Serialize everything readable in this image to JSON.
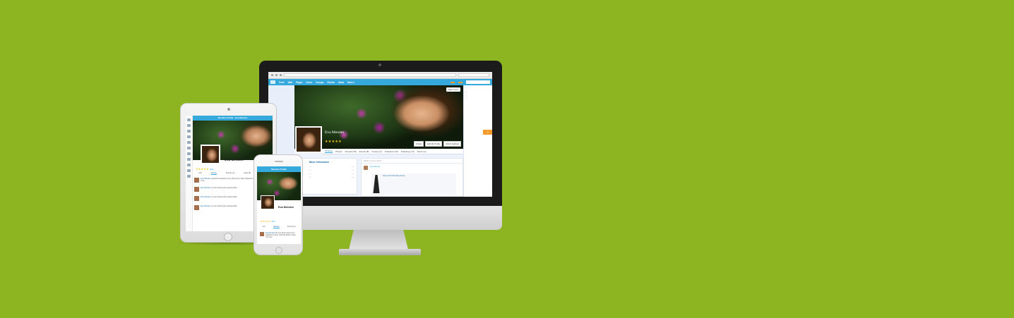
{
  "colors": {
    "background": "#8db522",
    "accent": "#35a9dc",
    "orange": "#f39c2c",
    "star": "#f5c518"
  },
  "desktop": {
    "nav": {
      "items": [
        "Feed",
        "Wall",
        "Pages",
        "Users",
        "Groups",
        "Events",
        "Ideas",
        "More ▾"
      ]
    },
    "profile": {
      "name": "Eva Mendes",
      "stars": "★★★★★",
      "edit_cover": "Edit Cover",
      "buttons": [
        "Follow",
        "Edit My Profile",
        "Admin Settings"
      ]
    },
    "tabs": [
      "Timeline",
      "Photos",
      "Friends (36)",
      "Events (8)",
      "Groups (2)",
      "Followers (18)",
      "Following (14)",
      "About me"
    ],
    "info": {
      "title": "Basic Information"
    },
    "feed": {
      "composer_placeholder": "What's on your mind?",
      "post_author": "Eva Mendes",
      "product_title": "Save 40 On Be Mine Dress"
    }
  },
  "tablet": {
    "bar_title": "Member Profile · Eva Mendes",
    "name": "Eva Mendes",
    "stars": "★★★★★",
    "rate_label": "Rate",
    "tabs": [
      "Info",
      "Activity",
      "Friends (4)",
      "Likes (8)",
      "Groups"
    ],
    "posts": [
      {
        "author": "Eva Mendes",
        "text": "posted the Newest Leon photo from New Collection Leon in the Book York"
      },
      {
        "author": "Eva Mendes",
        "text": "is now friends with Jessica Alba"
      },
      {
        "author": "Eva Mendes",
        "text": "is now friends with Jessica Alba"
      },
      {
        "author": "Eva Mendes",
        "text": "is now friends with Jessica Alba"
      }
    ]
  },
  "phone": {
    "bar_title": "Member Profile",
    "name": "Eva Mendes",
    "stars": "★★★★★",
    "rate_label": "Rate",
    "tabs": [
      "Info",
      "Updates",
      "Friends (4)"
    ],
    "post": {
      "author": "Eva Mendes",
      "text": "My new photo shoot to be published in New York Fall 2016 on New York City"
    }
  }
}
